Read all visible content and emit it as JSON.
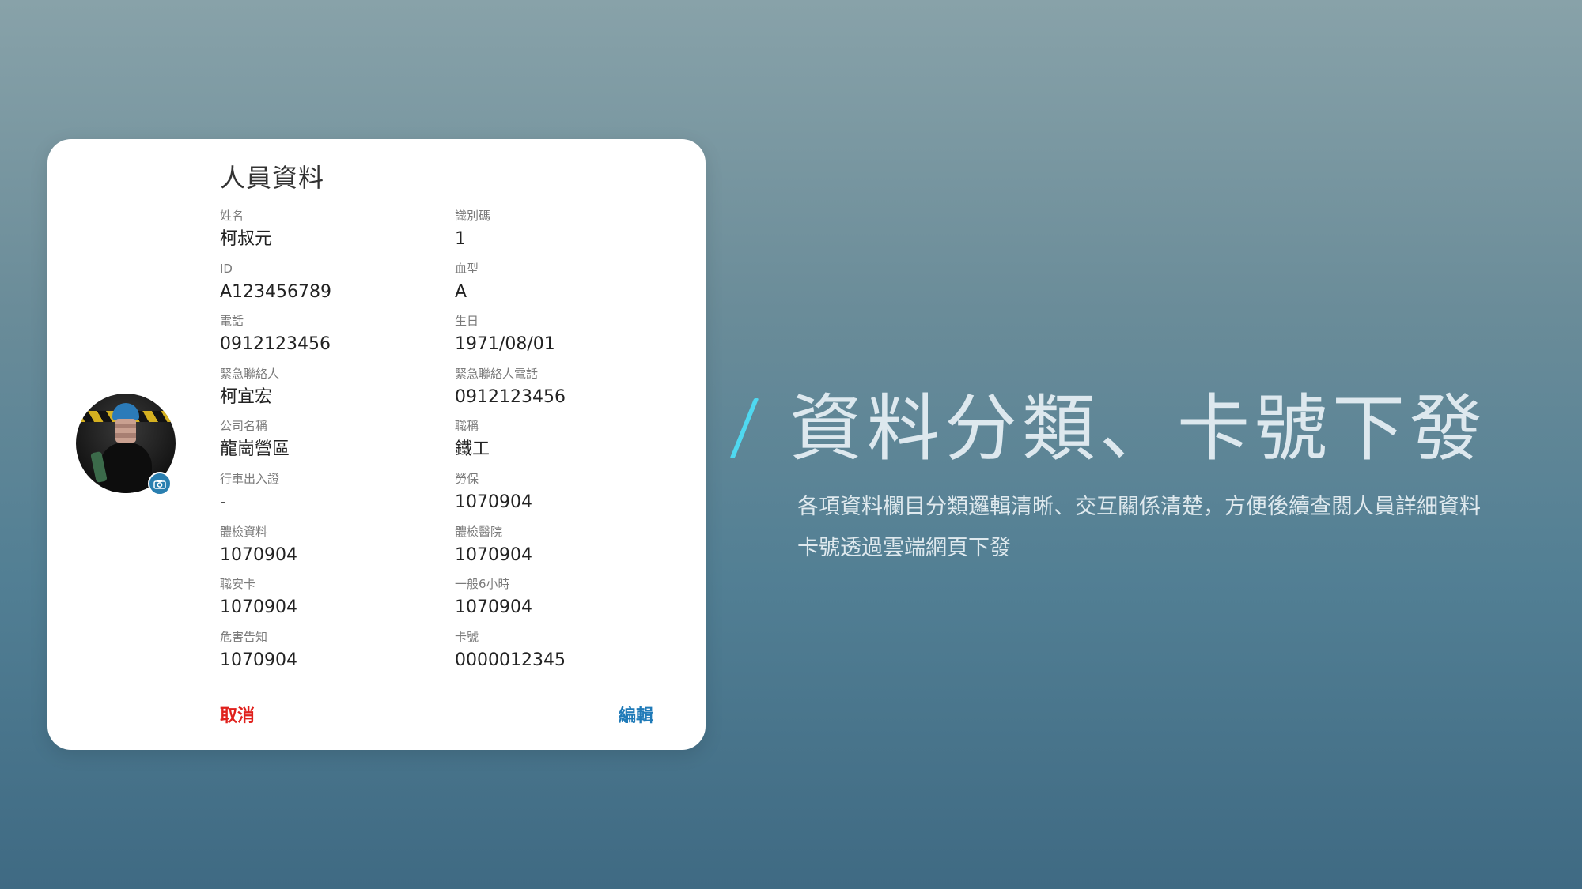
{
  "card": {
    "title": "人員資料",
    "fields_left": [
      {
        "label": "姓名",
        "value": "柯叔元"
      },
      {
        "label": "ID",
        "value": "A123456789"
      },
      {
        "label": "電話",
        "value": "0912123456"
      },
      {
        "label": "緊急聯絡人",
        "value": "柯宜宏"
      },
      {
        "label": "公司名稱",
        "value": "龍崗營區"
      },
      {
        "label": "行車出入證",
        "value": "-"
      },
      {
        "label": "體檢資料",
        "value": "1070904"
      },
      {
        "label": "職安卡",
        "value": "1070904"
      },
      {
        "label": "危害告知",
        "value": "1070904"
      }
    ],
    "fields_right": [
      {
        "label": "識別碼",
        "value": "1"
      },
      {
        "label": "血型",
        "value": "A"
      },
      {
        "label": "生日",
        "value": "1971/08/01"
      },
      {
        "label": "緊急聯絡人電話",
        "value": "0912123456"
      },
      {
        "label": "職稱",
        "value": "鐵工"
      },
      {
        "label": "勞保",
        "value": "1070904"
      },
      {
        "label": "體檢醫院",
        "value": "1070904"
      },
      {
        "label": "一般6小時",
        "value": "1070904"
      },
      {
        "label": "卡號",
        "value": "0000012345"
      }
    ],
    "cancel_label": "取消",
    "edit_label": "編輯",
    "avatar_icon": "worker-photo",
    "camera_icon": "camera-icon"
  },
  "feature": {
    "title": "資料分類、卡號下發",
    "desc_line1": "各項資料欄目分類邏輯清晰、交互關係清楚，方便後續查閱人員詳細資料",
    "desc_line2": "卡號透過雲端網頁下發"
  },
  "colors": {
    "cancel": "#e0201c",
    "edit": "#1f7ab8",
    "accent": "#4fd8f0"
  }
}
